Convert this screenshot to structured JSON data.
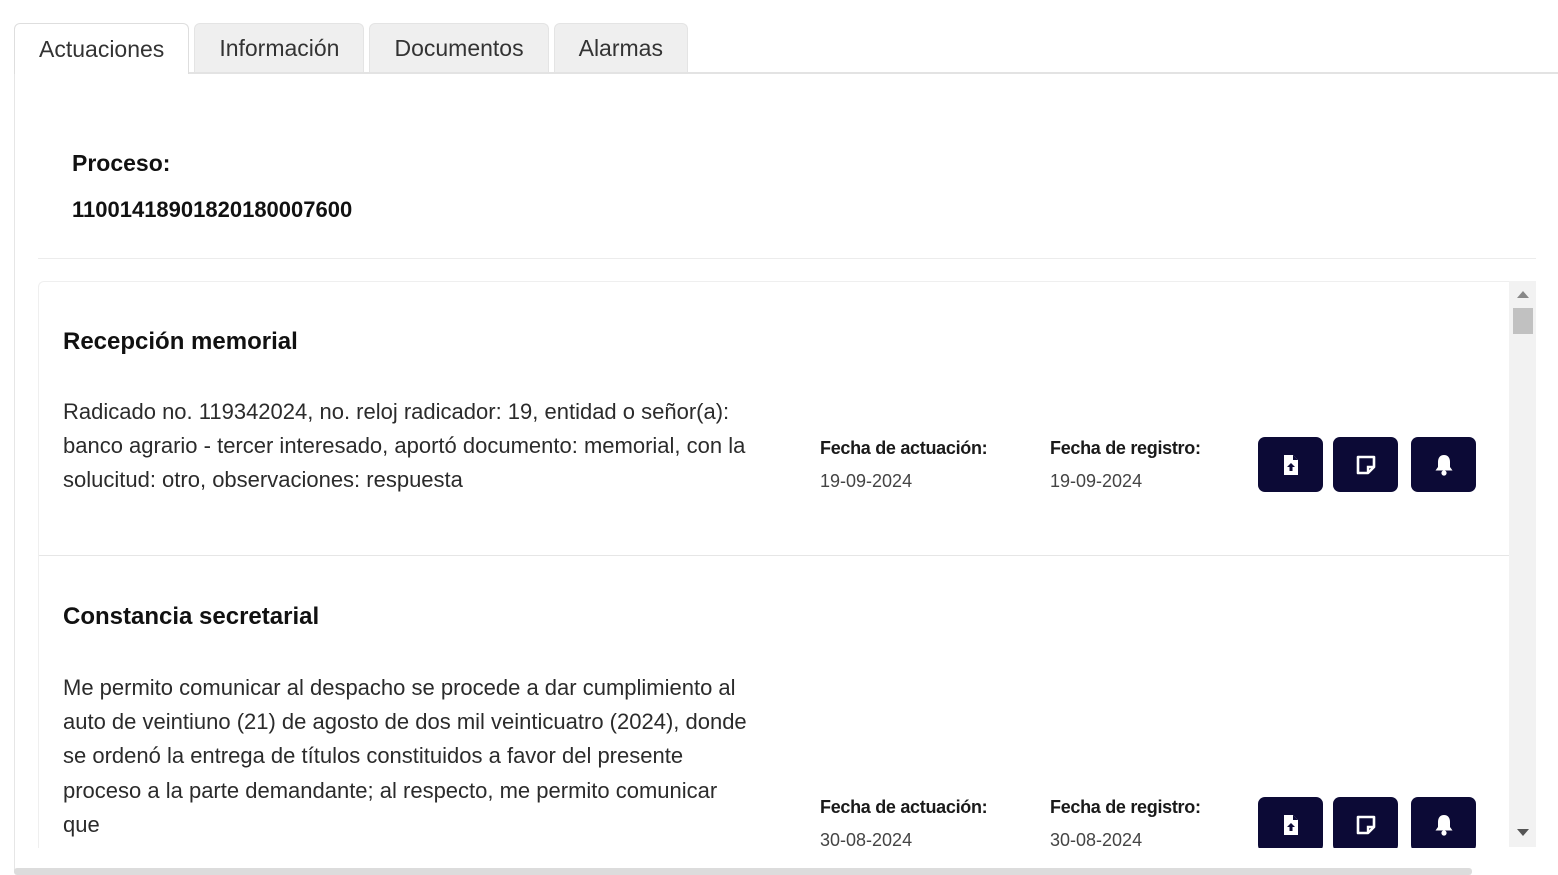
{
  "tabs": [
    {
      "label": "Actuaciones",
      "active": true
    },
    {
      "label": "Información",
      "active": false
    },
    {
      "label": "Documentos",
      "active": false
    },
    {
      "label": "Alarmas",
      "active": false
    }
  ],
  "proceso": {
    "label": "Proceso:",
    "number": "11001418901820180007600"
  },
  "actuaciones": [
    {
      "title": "Recepción memorial",
      "description": "Radicado no. 119342024, no. reloj radicador: 19, entidad o señor(a): banco agrario - tercer interesado, aportó documento: memorial, con la solucitud: otro, observaciones: respuesta",
      "fecha_actuacion_label": "Fecha de actuación:",
      "fecha_actuacion": "19-09-2024",
      "fecha_registro_label": "Fecha de registro:",
      "fecha_registro": "19-09-2024"
    },
    {
      "title": "Constancia secretarial",
      "description": "Me permito comunicar al despacho se procede a dar cumplimiento al auto de veintiuno (21) de agosto de dos mil veinticuatro (2024), donde se ordenó la entrega de títulos constituidos a favor del presente proceso a la parte demandante; al respecto, me permito comunicar que",
      "fecha_actuacion_label": "Fecha de actuación:",
      "fecha_actuacion": "30-08-2024",
      "fecha_registro_label": "Fecha de registro:",
      "fecha_registro": "30-08-2024"
    }
  ],
  "icons": {
    "upload_document": "file-upload-icon",
    "note": "sticky-note-icon",
    "alarm": "bell-icon"
  },
  "colors": {
    "button_bg": "#0c0a36",
    "tab_bg": "#efefef"
  }
}
